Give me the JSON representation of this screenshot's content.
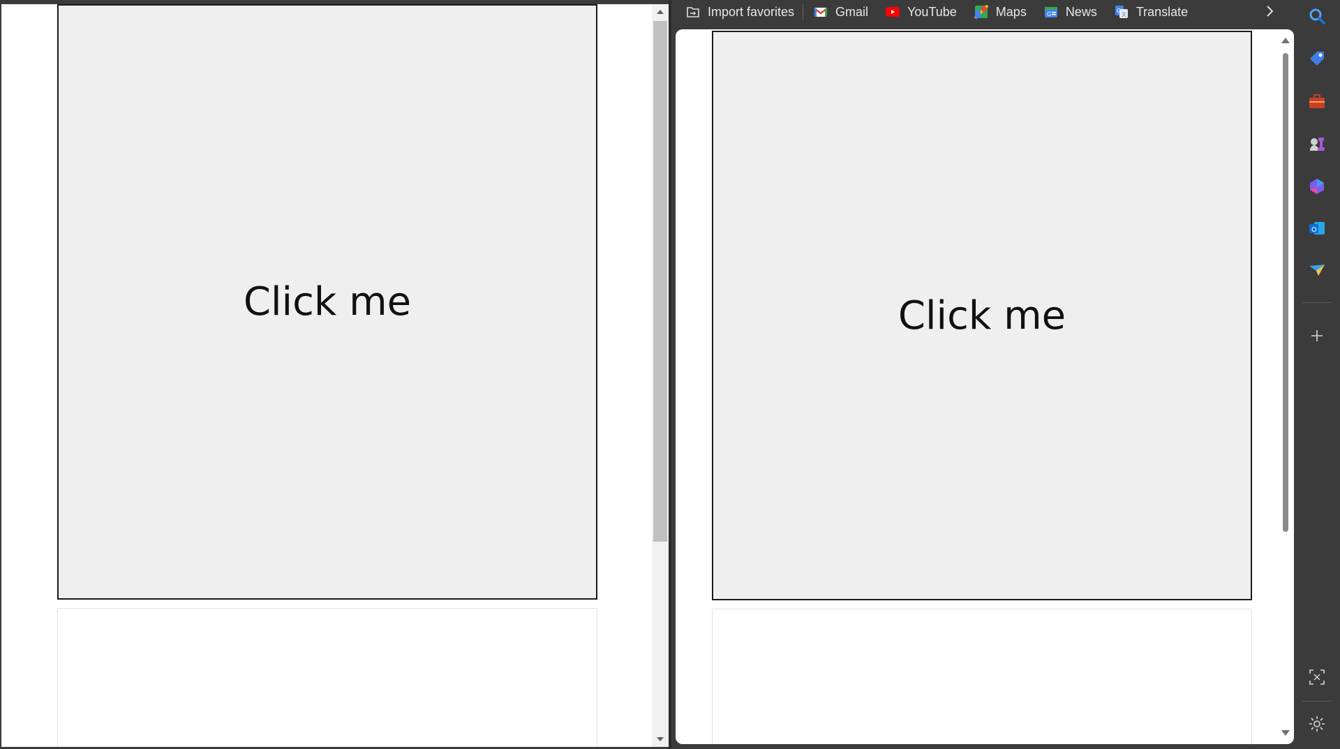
{
  "left_pane": {
    "click_box_label": "Click me"
  },
  "right_pane": {
    "favorites_bar": {
      "items": [
        {
          "label": "Import favorites",
          "icon": "import-favorites-icon"
        },
        {
          "label": "Gmail",
          "icon": "gmail-icon"
        },
        {
          "label": "YouTube",
          "icon": "youtube-icon"
        },
        {
          "label": "Maps",
          "icon": "maps-icon"
        },
        {
          "label": "News",
          "icon": "news-icon"
        },
        {
          "label": "Translate",
          "icon": "translate-icon"
        }
      ],
      "more_icon": "chevron-right-icon"
    },
    "page": {
      "click_box_label": "Click me"
    },
    "sidebar": {
      "icons": [
        "search-icon",
        "shopping-tag-icon",
        "tools-icon",
        "games-icon",
        "copilot-icon",
        "outlook-icon",
        "drop-icon",
        "add-icon",
        "screenshot-icon",
        "settings-icon"
      ]
    }
  },
  "colors": {
    "frame_background": "#3b3b3b",
    "click_box_fill": "#efefef",
    "click_box_border": "#1a1a1a",
    "youtube_red": "#ff0000",
    "outlook_blue": "#0a6fd4"
  }
}
